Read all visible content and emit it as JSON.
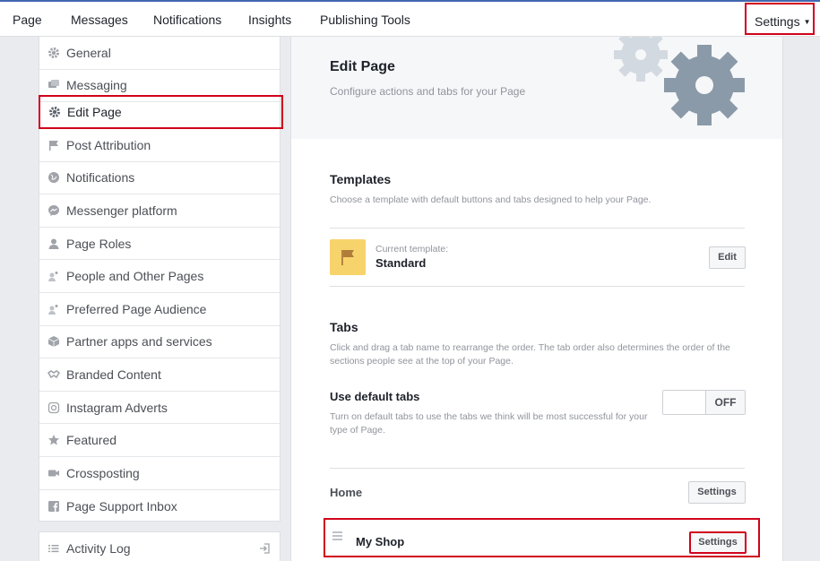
{
  "topnav": {
    "items": [
      "Page",
      "Messages",
      "Notifications",
      "Insights",
      "Publishing Tools"
    ],
    "settings_label": "Settings",
    "settings_caret": "▼"
  },
  "sidebar": {
    "items": [
      {
        "label": "General",
        "icon": "gear-icon"
      },
      {
        "label": "Messaging",
        "icon": "chat-icon"
      },
      {
        "label": "Edit Page",
        "icon": "gear-icon"
      },
      {
        "label": "Post Attribution",
        "icon": "flag-icon"
      },
      {
        "label": "Notifications",
        "icon": "globe-icon"
      },
      {
        "label": "Messenger platform",
        "icon": "messenger-icon"
      },
      {
        "label": "Page Roles",
        "icon": "person-icon"
      },
      {
        "label": "People and Other Pages",
        "icon": "people-icon"
      },
      {
        "label": "Preferred Page Audience",
        "icon": "people-icon"
      },
      {
        "label": "Partner apps and services",
        "icon": "box-icon"
      },
      {
        "label": "Branded Content",
        "icon": "handshake-icon"
      },
      {
        "label": "Instagram Adverts",
        "icon": "instagram-icon"
      },
      {
        "label": "Featured",
        "icon": "star-icon"
      },
      {
        "label": "Crossposting",
        "icon": "video-icon"
      },
      {
        "label": "Page Support Inbox",
        "icon": "facebook-icon"
      }
    ],
    "activity_log": "Activity Log"
  },
  "header": {
    "title": "Edit Page",
    "subtitle": "Configure actions and tabs for your Page"
  },
  "templates": {
    "title": "Templates",
    "description": "Choose a template with default buttons and tabs designed to help your Page.",
    "current_label": "Current template:",
    "current_value": "Standard",
    "edit_button": "Edit"
  },
  "tabs": {
    "title": "Tabs",
    "description_line1": "Click and drag a tab name to rearrange the order. The tab order also determines the order of the",
    "description_line2": "sections people see at the top of your Page.",
    "default_tabs_label": "Use default tabs",
    "default_tabs_desc_line1": "Turn on default tabs to use the tabs we think will be most successful for your",
    "default_tabs_desc_line2": "type of Page.",
    "toggle_state": "OFF",
    "rows": [
      {
        "name": "Home",
        "button": "Settings"
      },
      {
        "name": "My Shop",
        "button": "Settings"
      }
    ]
  },
  "colors": {
    "highlight": "#d0021b",
    "brand": "#4267b2",
    "template_icon_bg": "#f7d36b"
  }
}
